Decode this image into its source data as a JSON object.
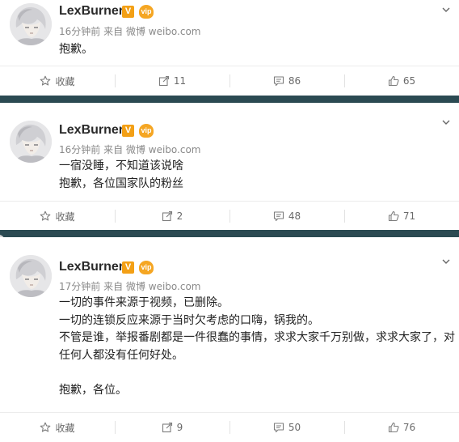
{
  "colors": {
    "separator": "#2b4a52",
    "verified": "#f3a016",
    "meta": "#8a8a8a"
  },
  "posts": [
    {
      "username": "LexBurner",
      "verified_badge": "V",
      "vip_badge": "vip",
      "time": "16分钟前",
      "source_prefix": "来自",
      "source": "微博 weibo.com",
      "content": [
        "抱歉。"
      ],
      "actions": {
        "favorite": "收藏",
        "repost": "11",
        "comment": "86",
        "like": "65"
      }
    },
    {
      "username": "LexBurner",
      "verified_badge": "V",
      "vip_badge": "vip",
      "time": "16分钟前",
      "source_prefix": "来自",
      "source": "微博 weibo.com",
      "content": [
        "一宿没睡，不知道该说啥",
        "抱歉，各位国家队的粉丝"
      ],
      "actions": {
        "favorite": "收藏",
        "repost": "2",
        "comment": "48",
        "like": "71"
      }
    },
    {
      "username": "LexBurner",
      "verified_badge": "V",
      "vip_badge": "vip",
      "time": "17分钟前",
      "source_prefix": "来自",
      "source": "微博 weibo.com",
      "content": [
        "一切的事件来源于视频，已删除。",
        "一切的连锁反应来源于当时欠考虑的口嗨，锅我的。",
        "不管是谁，举报番剧都是一件很蠢的事情，求求大家千万别做，求求大家了，对",
        "任何人都没有任何好处。",
        "",
        "抱歉，各位。"
      ],
      "actions": {
        "favorite": "收藏",
        "repost": "9",
        "comment": "50",
        "like": "76"
      }
    }
  ]
}
